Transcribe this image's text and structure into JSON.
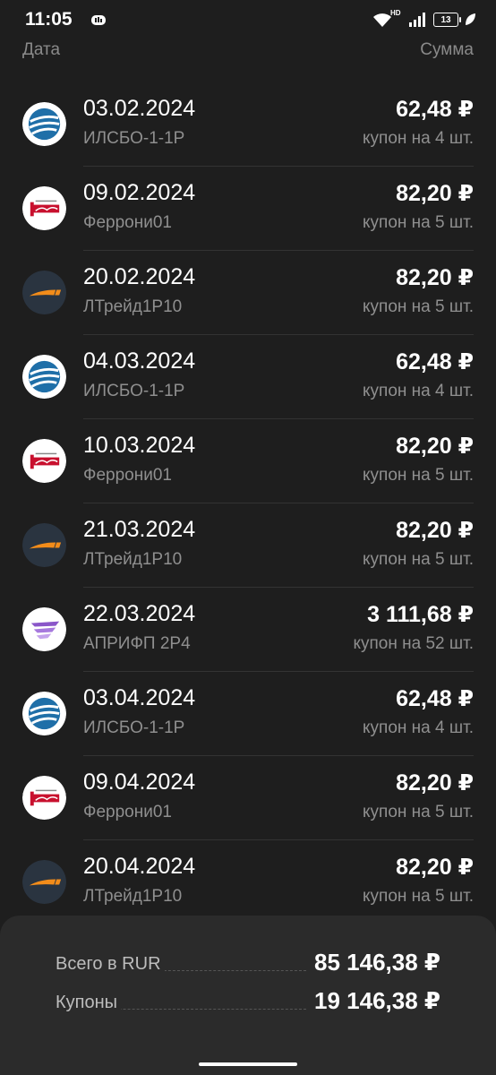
{
  "status_bar": {
    "time": "11:05",
    "network": "HD",
    "battery": "13"
  },
  "columns": {
    "date": "Дата",
    "sum": "Сумма"
  },
  "payments": [
    {
      "date": "03.02.2024",
      "name": "ИЛСБО-1-1Р",
      "amount": "62,48 ₽",
      "qty": "купон на 4 шт.",
      "logo": "ilsbo-logo-icon"
    },
    {
      "date": "09.02.2024",
      "name": "Феррони01",
      "amount": "82,20 ₽",
      "qty": "купон на 5 шт.",
      "logo": "ferroni-logo-icon"
    },
    {
      "date": "20.02.2024",
      "name": "ЛТрейд1Р10",
      "amount": "82,20 ₽",
      "qty": "купон на 5 шт.",
      "logo": "ltrade-logo-icon"
    },
    {
      "date": "04.03.2024",
      "name": "ИЛСБО-1-1Р",
      "amount": "62,48 ₽",
      "qty": "купон на 4 шт.",
      "logo": "ilsbo-logo-icon"
    },
    {
      "date": "10.03.2024",
      "name": "Феррони01",
      "amount": "82,20 ₽",
      "qty": "купон на 5 шт.",
      "logo": "ferroni-logo-icon"
    },
    {
      "date": "21.03.2024",
      "name": "ЛТрейд1Р10",
      "amount": "82,20 ₽",
      "qty": "купон на 5 шт.",
      "logo": "ltrade-logo-icon"
    },
    {
      "date": "22.03.2024",
      "name": "АПРИФП 2Р4",
      "amount": "3 111,68 ₽",
      "qty": "купон на 52 шт.",
      "logo": "aprifp-logo-icon"
    },
    {
      "date": "03.04.2024",
      "name": "ИЛСБО-1-1Р",
      "amount": "62,48 ₽",
      "qty": "купон на 4 шт.",
      "logo": "ilsbo-logo-icon"
    },
    {
      "date": "09.04.2024",
      "name": "Феррони01",
      "amount": "82,20 ₽",
      "qty": "купон на 5 шт.",
      "logo": "ferroni-logo-icon"
    },
    {
      "date": "20.04.2024",
      "name": "ЛТрейд1Р10",
      "amount": "82,20 ₽",
      "qty": "купон на 5 шт.",
      "logo": "ltrade-logo-icon"
    }
  ],
  "summary": {
    "total_label": "Всего в RUR",
    "total_value": "85 146,38 ₽",
    "coupons_label": "Купоны",
    "coupons_value": "19 146,38 ₽"
  },
  "colors": {
    "background": "#1e1e1e",
    "summary_panel": "#2b2b2b",
    "secondary_text": "#8f8f8f",
    "ilsbo_blue": "#1f6fa8",
    "ferroni_red": "#c8102e",
    "ltrade_orange": "#f28c1a",
    "ltrade_dark": "#2a3440",
    "aprifp_purple": "#8a56c9"
  }
}
